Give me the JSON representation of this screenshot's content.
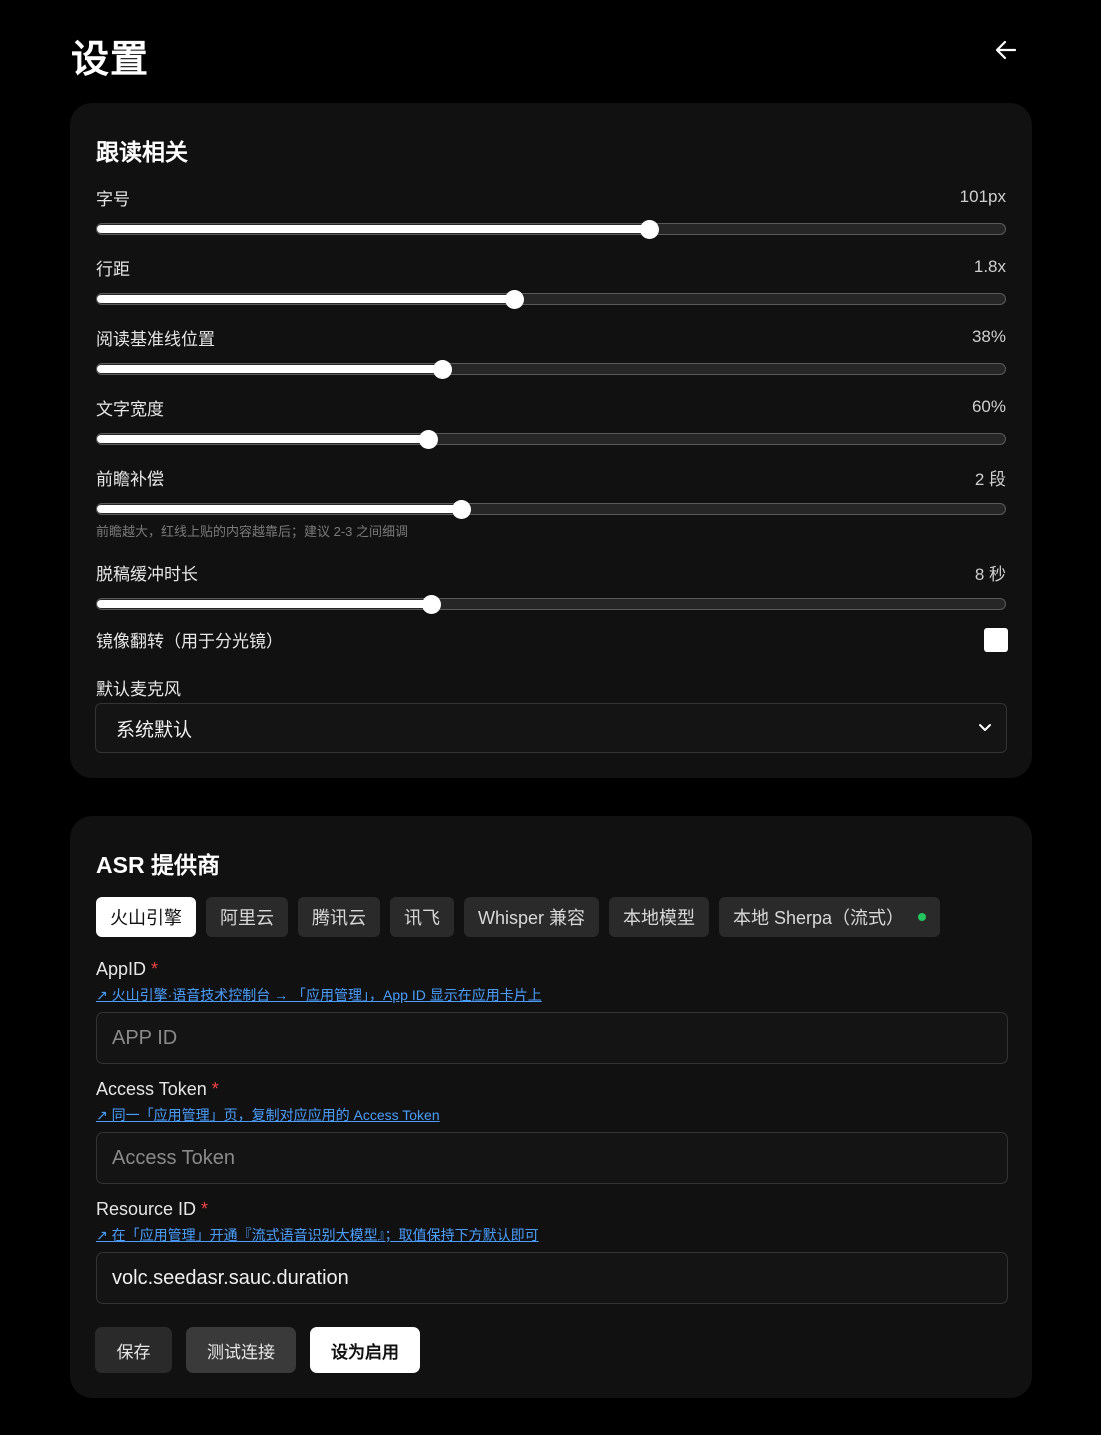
{
  "page": {
    "title": "设置"
  },
  "reading": {
    "title": "跟读相关",
    "sliders": [
      {
        "label": "字号",
        "value_text": "101px",
        "fraction": 0.608
      },
      {
        "label": "行距",
        "value_text": "1.8x",
        "fraction": 0.459
      },
      {
        "label": "阅读基准线位置",
        "value_text": "38%",
        "fraction": 0.38
      },
      {
        "label": "文字宽度",
        "value_text": "60%",
        "fraction": 0.364
      },
      {
        "label": "前瞻补偿",
        "value_text": "2 段",
        "fraction": 0.401,
        "hint": "前瞻越大，红线上贴的内容越靠后；建议 2-3 之间细调"
      },
      {
        "label": "脱稿缓冲时长",
        "value_text": "8 秒",
        "fraction": 0.368
      }
    ],
    "mirror_label": "镜像翻转（用于分光镜）",
    "mirror_checked": false,
    "mic_label": "默认麦克风",
    "mic_value": "系统默认"
  },
  "asr": {
    "title": "ASR 提供商",
    "tabs": [
      {
        "label": "火山引擎",
        "active": true
      },
      {
        "label": "阿里云"
      },
      {
        "label": "腾讯云"
      },
      {
        "label": "讯飞"
      },
      {
        "label": "Whisper 兼容"
      },
      {
        "label": "本地模型"
      },
      {
        "label": "本地 Sherpa（流式）",
        "status": "online"
      }
    ],
    "fields": [
      {
        "label": "AppID",
        "required": "*",
        "link": "↗ 火山引擎·语音技术控制台 → 「应用管理」，App ID 显示在应用卡片上",
        "placeholder": "APP ID",
        "value": ""
      },
      {
        "label": "Access Token",
        "required": "*",
        "link": "↗ 同一「应用管理」页，复制对应应用的 Access Token",
        "placeholder": "Access Token",
        "value": ""
      },
      {
        "label": "Resource ID",
        "required": "*",
        "link": "↗ 在「应用管理」开通『流式语音识别大模型』；取值保持下方默认即可",
        "placeholder": "",
        "value": "volc.seedasr.sauc.duration"
      }
    ],
    "buttons": {
      "save": "保存",
      "test": "测试连接",
      "enable": "设为启用"
    }
  },
  "colors": {
    "accent_link": "#4a9eff",
    "required": "#ef4444",
    "status_online": "#22c55e"
  }
}
